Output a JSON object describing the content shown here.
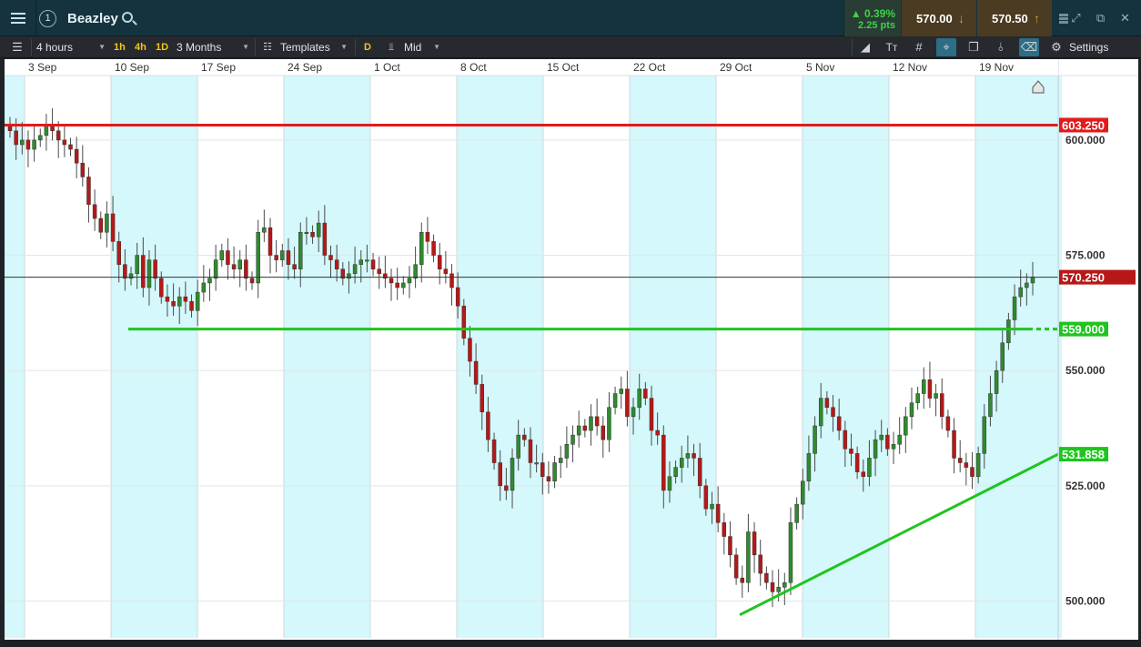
{
  "header": {
    "menu_icon": "hamburger-icon",
    "watchlist_number": "1",
    "instrument": "Beazley",
    "search_icon": "search-icon",
    "change_pct": "▲ 0.39%",
    "change_pts": "2.25 pts",
    "sell_price": "570.00",
    "buy_price": "570.50",
    "sell_arrow": "↓",
    "buy_arrow": "↑",
    "icons": [
      "bars-icon",
      "expand-icon",
      "popout-icon",
      "close-icon"
    ]
  },
  "toolbar": {
    "list_icon": "list-icon",
    "interval": "4 hours",
    "quick_1h": "1h",
    "quick_4h": "4h",
    "quick_1d": "1D",
    "range": "3 Months",
    "templates": "Templates",
    "d_label": "D",
    "price_type": "Mid",
    "settings": "Settings",
    "tool_icons": [
      "trendline-icon",
      "text-tool-icon",
      "grid-icon",
      "crosshair-icon",
      "layers-icon",
      "indicator-icon",
      "tag-icon",
      "gear-icon"
    ]
  },
  "chart_data": {
    "type": "candlestick",
    "title": "",
    "x_ticks": [
      "3 Sep",
      "10 Sep",
      "17 Sep",
      "24 Sep",
      "1 Oct",
      "8 Oct",
      "15 Oct",
      "22 Oct",
      "29 Oct",
      "5 Nov",
      "12 Nov",
      "19 Nov"
    ],
    "y_ticks": [
      525,
      550,
      575,
      600
    ],
    "y_tick_labels": [
      "525.000",
      "550.000",
      "575.000",
      "600.000"
    ],
    "y_extra_label": "500.000",
    "ylim": [
      492,
      614
    ],
    "current_price": 570.25,
    "current_price_label": "570.250",
    "horizontal_lines": [
      {
        "price": 603.25,
        "label": "603.250",
        "color": "#e11b1b"
      },
      {
        "price": 559.0,
        "label": "559.000",
        "color": "#1fc41f"
      }
    ],
    "trendline": {
      "from_date": "31 Oct",
      "from_price": 497.0,
      "to_date": "23 Nov",
      "to_price": 531.858,
      "label": "531.858",
      "color": "#1fc41f"
    },
    "up_color": "#2e8b2e",
    "down_color": "#b81717",
    "shaded_weeks_color": "#d4f8fb",
    "closes": [
      602,
      599,
      600,
      598,
      600,
      601,
      603,
      602,
      600,
      599,
      598,
      595,
      592,
      586,
      583,
      580,
      584,
      578,
      573,
      570,
      571,
      575,
      568,
      574,
      570,
      566,
      565,
      564,
      566,
      565,
      563,
      567,
      569,
      570,
      574,
      576,
      573,
      572,
      574,
      570,
      569,
      580,
      581,
      575,
      574,
      576,
      573,
      572,
      580,
      580,
      579,
      582,
      575,
      574,
      572,
      570,
      571,
      573,
      574,
      574,
      572,
      571,
      570,
      569,
      568,
      569,
      570,
      573,
      580,
      578,
      575,
      572,
      571,
      568,
      564,
      557,
      552,
      547,
      541,
      535,
      530,
      525,
      524,
      531,
      536,
      535,
      530,
      530,
      527,
      526,
      530,
      531,
      534,
      536,
      538,
      537,
      540,
      538,
      535,
      542,
      545,
      546,
      540,
      542,
      546,
      544,
      537,
      536,
      524,
      527,
      529,
      531,
      532,
      531,
      525,
      520,
      521,
      517,
      514,
      510,
      505,
      504,
      515,
      510,
      506,
      504,
      502,
      503,
      504,
      517,
      521,
      526,
      532,
      538,
      544,
      542,
      540,
      537,
      533,
      532,
      528,
      527,
      531,
      535,
      536,
      533,
      534,
      536,
      540,
      543,
      545,
      548,
      544,
      545,
      540,
      537,
      531,
      530,
      529,
      527,
      532,
      540,
      545,
      550,
      556,
      561,
      566,
      568,
      569,
      570.25
    ]
  }
}
